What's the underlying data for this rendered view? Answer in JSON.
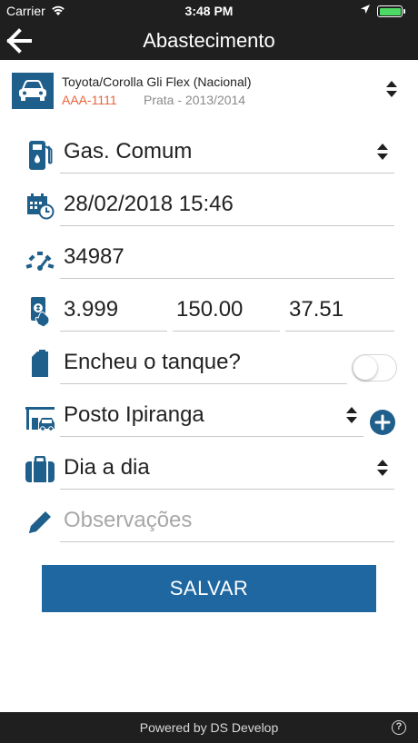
{
  "status_bar": {
    "carrier": "Carrier",
    "time": "3:48 PM",
    "battery_level": 1.0
  },
  "header": {
    "title": "Abastecimento",
    "back_icon": "arrow-left-icon"
  },
  "vehicle": {
    "name": "Toyota/Corolla Gli Flex (Nacional)",
    "plate": "AAA-1111",
    "details": "Prata - 2013/2014",
    "icon": "car-icon"
  },
  "form": {
    "fuel_type": "Gas. Comum",
    "datetime": "28/02/2018 15:46",
    "odometer": "34987",
    "price_per_liter": "3.999",
    "total_value": "150.00",
    "liters": "37.51",
    "full_tank_label": "Encheu o tanque?",
    "full_tank_on": false,
    "station": "Posto Ipiranga",
    "category": "Dia a dia",
    "notes_placeholder": "Observações"
  },
  "actions": {
    "save_label": "SALVAR"
  },
  "footer": {
    "powered_by": "Powered by DS Develop",
    "help_label": "?"
  },
  "colors": {
    "accent": "#1f5f8b",
    "button": "#1f67a0",
    "plate": "#e7653b",
    "bar": "#1f1f1f",
    "battery": "#4cd964"
  }
}
